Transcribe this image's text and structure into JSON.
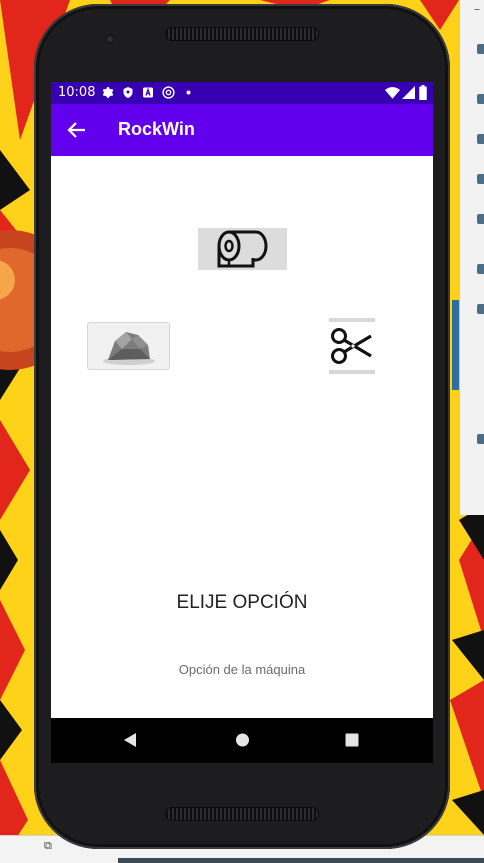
{
  "status_bar": {
    "time": "10:08",
    "left_icons": [
      "gear-icon",
      "shield-icon",
      "a-icon",
      "at-icon",
      "dot-icon"
    ],
    "right_icons": [
      "wifi-icon",
      "signal-icon",
      "battery-icon"
    ]
  },
  "app_bar": {
    "title": "RockWin",
    "back_icon": "arrow-left-icon",
    "color": "#6200ee",
    "status_color": "#3700b3"
  },
  "game": {
    "options": [
      {
        "id": "paper",
        "icon": "toilet-paper-icon"
      },
      {
        "id": "rock",
        "icon": "rock-icon"
      },
      {
        "id": "scissors",
        "icon": "scissors-icon"
      }
    ],
    "prompt": "ELIJE OPCIÓN",
    "machine_label": "Opción de la máquina"
  },
  "nav_bar": {
    "buttons": [
      "back-triangle-icon",
      "home-circle-icon",
      "recents-square-icon"
    ]
  }
}
